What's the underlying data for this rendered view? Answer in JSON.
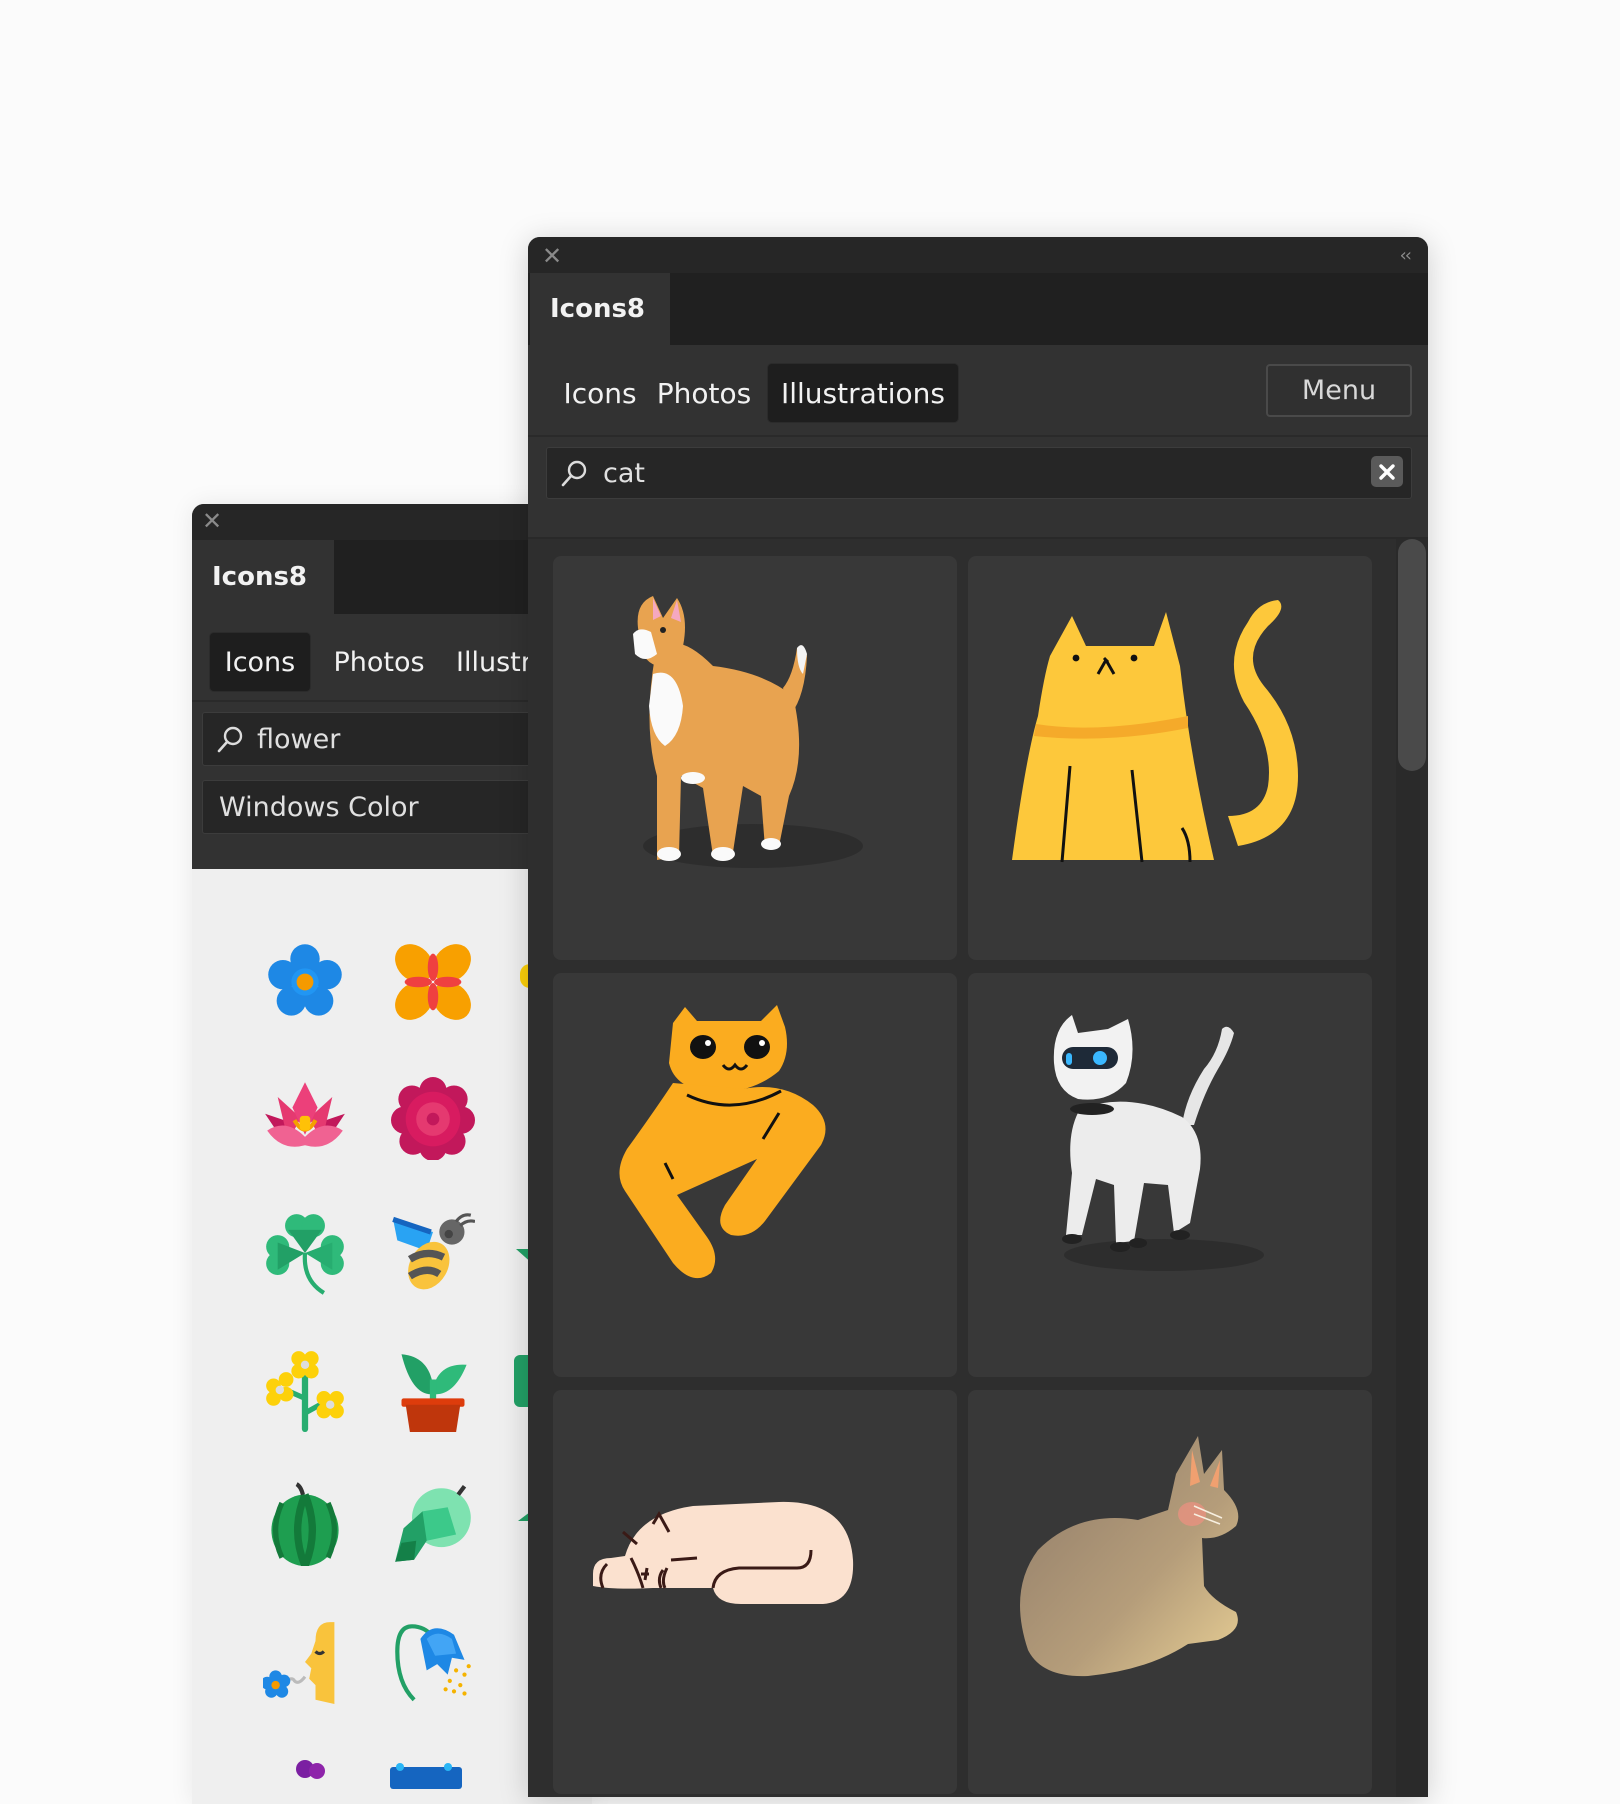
{
  "back_panel": {
    "close_icon": "close-icon",
    "doc_tab": "Icons8",
    "nav_tabs": [
      {
        "label": "Icons",
        "active": true
      },
      {
        "label": "Photos",
        "active": false
      },
      {
        "label": "Illustrations",
        "active": false
      }
    ],
    "search": {
      "icon": "search-icon",
      "value": "flower"
    },
    "style_select": {
      "value": "Windows Color"
    },
    "icons": [
      {
        "name": "blue-flower-icon"
      },
      {
        "name": "orange-flower-icon"
      },
      {
        "name": "lotus-icon"
      },
      {
        "name": "red-flower-icon"
      },
      {
        "name": "clover-icon"
      },
      {
        "name": "bee-icon"
      },
      {
        "name": "rapeseed-icon"
      },
      {
        "name": "potted-plant-icon"
      },
      {
        "name": "watermelon-icon"
      },
      {
        "name": "hops-icon"
      },
      {
        "name": "smell-flower-icon"
      },
      {
        "name": "bluebell-pollen-icon"
      },
      {
        "name": "violet-icon"
      },
      {
        "name": "blue-item-icon"
      }
    ]
  },
  "front_panel": {
    "close_icon": "close-icon",
    "collapse_icon": "double-chevron-left-icon",
    "collapse_glyph": "‹‹",
    "doc_tab": "Icons8",
    "nav_tabs": [
      {
        "label": "Icons",
        "active": false
      },
      {
        "label": "Photos",
        "active": false
      },
      {
        "label": "Illustrations",
        "active": true
      }
    ],
    "menu_button": "Menu",
    "search": {
      "icon": "search-icon",
      "value": "cat",
      "clear_icon": "clear-icon"
    },
    "results": [
      {
        "name": "3d-orange-cat-illustration"
      },
      {
        "name": "yellow-sitting-cat-illustration"
      },
      {
        "name": "orange-lounging-cat-illustration"
      },
      {
        "name": "robot-cat-illustration"
      },
      {
        "name": "sleeping-cat-illustration"
      },
      {
        "name": "sitting-beige-cat-illustration"
      }
    ],
    "scroll_position": 0
  }
}
